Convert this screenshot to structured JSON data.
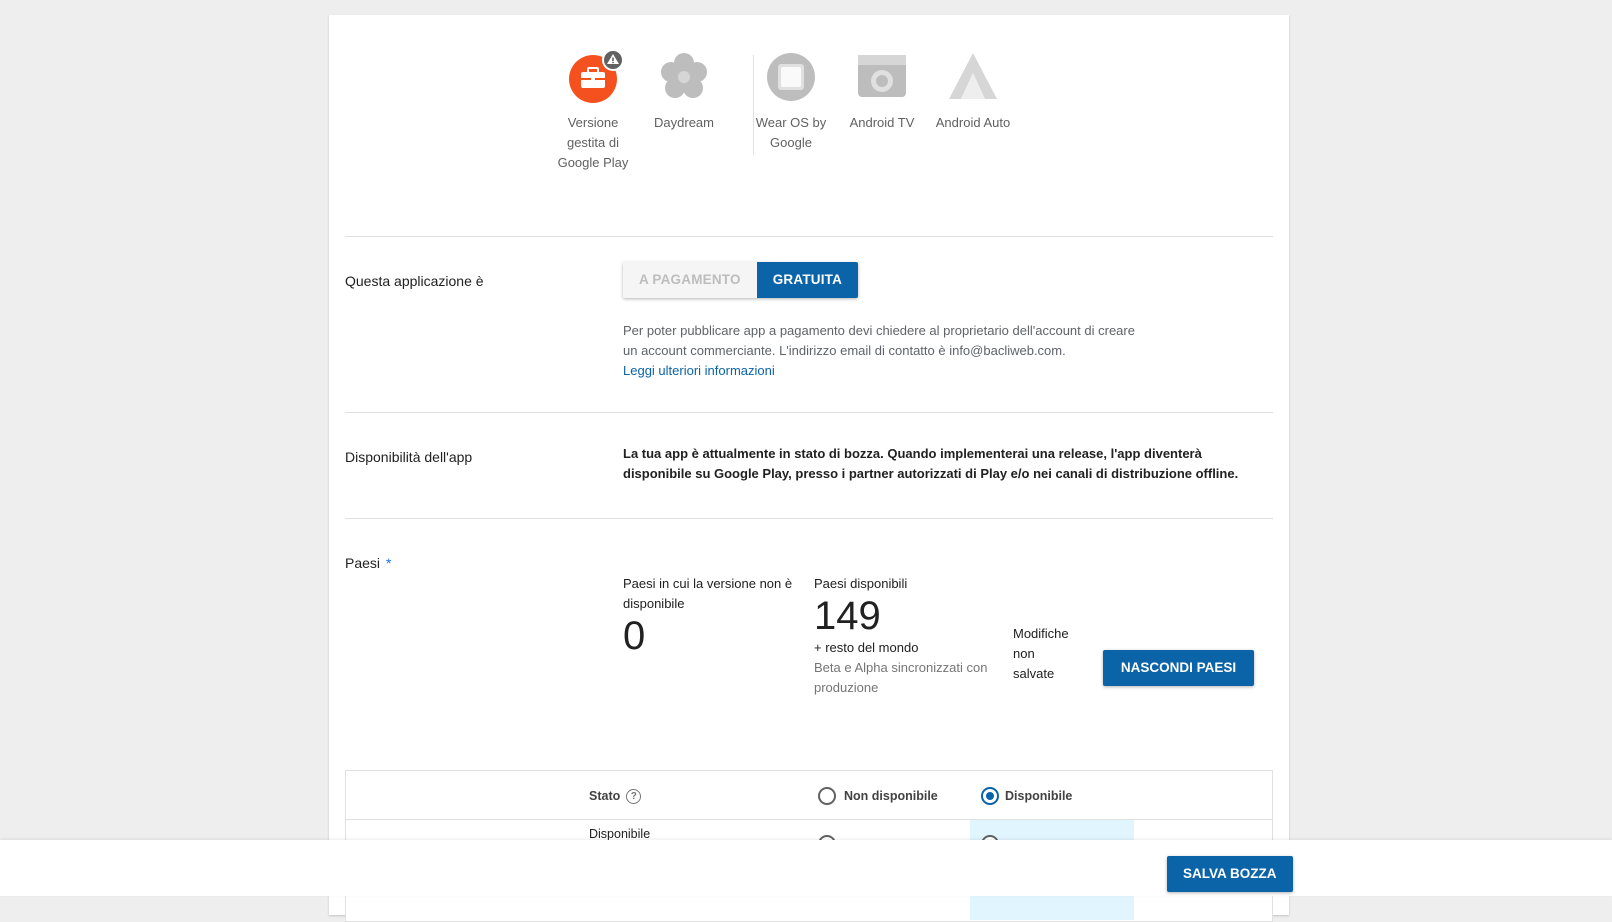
{
  "devices": [
    {
      "label": "Versione gestita di Google Play",
      "icon": "briefcase-warning-icon"
    },
    {
      "label": "Daydream",
      "icon": "daydream-icon"
    },
    {
      "label": "Wear OS by Google",
      "icon": "watch-icon"
    },
    {
      "label": "Android TV",
      "icon": "tv-icon"
    },
    {
      "label": "Android Auto",
      "icon": "auto-icon"
    }
  ],
  "pricing": {
    "label": "Questa applicazione è",
    "paid": "A PAGAMENTO",
    "free": "GRATUITA",
    "selected": "GRATUITA",
    "help_text": "Per poter pubblicare app a pagamento devi chiedere al proprietario dell'account di creare un account commerciante. L'indirizzo email di contatto è info@bacliweb.com.",
    "link": "Leggi ulteriori informazioni"
  },
  "availability": {
    "label": "Disponibilità dell'app",
    "text": "La tua app è attualmente in stato di bozza. Quando implementerai una release, l'app diventerà disponibile su Google Play, presso i partner autorizzati di Play e/o nei canali di distribuzione offline."
  },
  "countries": {
    "label": "Paesi",
    "required_mark": "*",
    "unavailable_label": "Paesi in cui la versione non è disponibile",
    "unavailable_count": "0",
    "available_label": "Paesi disponibili",
    "available_count": "149",
    "rest_of_world": "+ resto del mondo",
    "sync_note": "Beta e Alpha sincronizzati con produzione",
    "unsaved": "Modifiche non salvate",
    "hide_button": "NASCONDI PAESI"
  },
  "table": {
    "status_header": "Stato",
    "not_available": "Non disponibile",
    "available": "Disponibile",
    "header_selected": "Disponibile",
    "row_status": "Disponibile"
  },
  "footer": {
    "save_draft": "SALVA BOZZA"
  },
  "colors": {
    "primary": "#0b63a8",
    "warning_red": "#f4511e",
    "highlight": "#e1f5fe"
  }
}
